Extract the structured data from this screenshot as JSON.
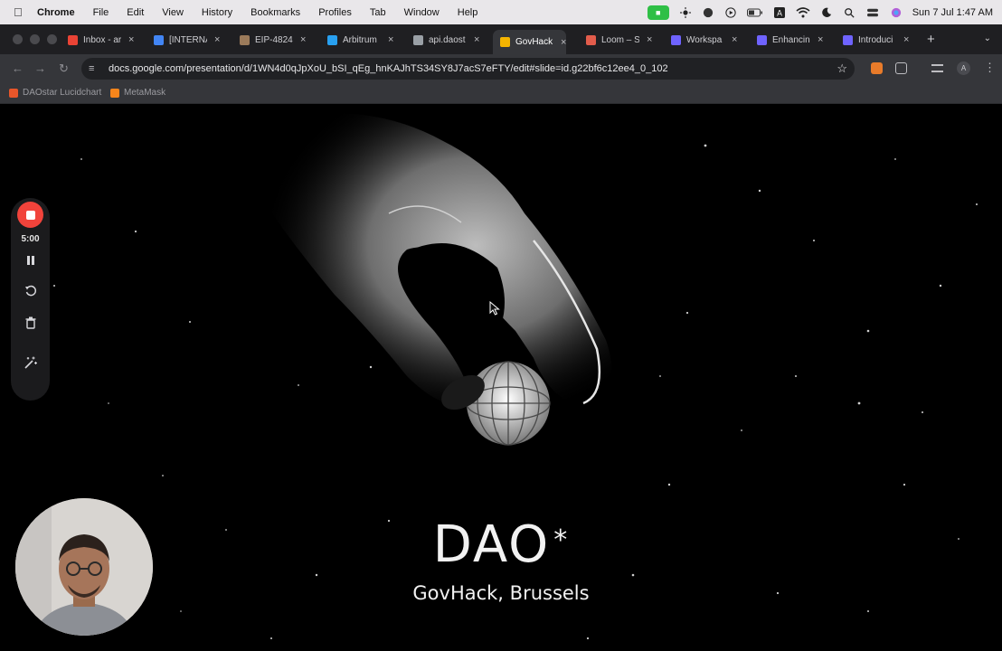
{
  "menubar": {
    "app_name": "Chrome",
    "items": [
      "File",
      "Edit",
      "View",
      "History",
      "Bookmarks",
      "Profiles",
      "Tab",
      "Window",
      "Help"
    ],
    "clock": "Sun 7 Jul  1:47 AM"
  },
  "tabs": [
    {
      "label": "Inbox - ar",
      "icon": "gmail-icon",
      "color": "#ea4335"
    },
    {
      "label": "[INTERNA",
      "icon": "google-docs-icon",
      "color": "#4285f4"
    },
    {
      "label": "EIP-4824",
      "icon": "eip-icon",
      "color": "#9b7a5a"
    },
    {
      "label": "Arbitrum",
      "icon": "arbitrum-icon",
      "color": "#28a0f0"
    },
    {
      "label": "api.daost",
      "icon": "globe-icon",
      "color": "#9aa0a6"
    },
    {
      "label": "GovHack",
      "icon": "google-slides-icon",
      "color": "#f4b400",
      "active": true
    },
    {
      "label": "Loom – S",
      "icon": "loom-icon",
      "color": "#e25c4b"
    },
    {
      "label": "Workspa",
      "icon": "workspace-icon",
      "color": "#6f63ff"
    },
    {
      "label": "Enhancin",
      "icon": "enhance-icon",
      "color": "#6f63ff"
    },
    {
      "label": "Introduci",
      "icon": "intro-icon",
      "color": "#6f63ff"
    }
  ],
  "address_bar": {
    "url": "docs.google.com/presentation/d/1WN4d0qJpXoU_bSI_qEg_hnKAJhTS34SY8J7acS7eFTY/edit#slide=id.g22bf6c12ee4_0_102"
  },
  "bookmarks": [
    {
      "label": "DAOstar Lucidchart",
      "icon": "lucidchart-icon",
      "color": "#e8562a"
    },
    {
      "label": "MetaMask",
      "icon": "metamask-icon",
      "color": "#f6851b"
    }
  ],
  "slide": {
    "title": "DAO",
    "title_mark": "*",
    "subtitle": "GovHack, Brussels"
  },
  "loom": {
    "timer": "5:00"
  },
  "profile_initial": "A"
}
